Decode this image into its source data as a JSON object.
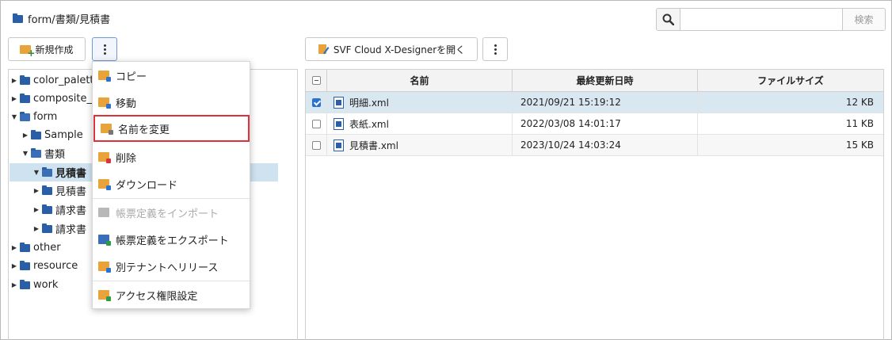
{
  "breadcrumb": {
    "path": "form/書類/見積書",
    "icon": "folder-icon"
  },
  "search": {
    "placeholder": "",
    "submit_label": "検索",
    "icon": "search-icon"
  },
  "toolbar": {
    "new_label": "新規作成",
    "designer_label": "SVF Cloud X-Designerを開く"
  },
  "tree": {
    "items": [
      {
        "label": "color_palette",
        "visible": "color_palett",
        "arrow": "▶"
      },
      {
        "label": "composite_",
        "visible": "composite_",
        "arrow": "▶"
      },
      {
        "label": "form",
        "arrow": "▼"
      },
      {
        "label": "Sample",
        "arrow": "▶"
      },
      {
        "label": "書類",
        "arrow": "▼"
      },
      {
        "label": "見積書",
        "arrow": "▼"
      },
      {
        "label": "見積書",
        "arrow": "▶"
      },
      {
        "label": "請求書",
        "arrow": "▶"
      },
      {
        "label": "請求書",
        "arrow": "▶"
      },
      {
        "label": "other",
        "arrow": "▶"
      },
      {
        "label": "resource",
        "arrow": "▶"
      },
      {
        "label": "work",
        "arrow": "▶"
      }
    ]
  },
  "table": {
    "headers": [
      "名前",
      "最終更新日時",
      "ファイルサイズ"
    ],
    "rows": [
      {
        "name": "明細.xml",
        "modified": "2021/09/21 15:19:12",
        "size": "12 KB",
        "checked": true
      },
      {
        "name": "表紙.xml",
        "modified": "2022/03/08 14:01:17",
        "size": "11 KB",
        "checked": false
      },
      {
        "name": "見積書.xml",
        "modified": "2023/10/24 14:03:24",
        "size": "15 KB",
        "checked": false
      }
    ]
  },
  "menu": {
    "items": [
      {
        "label": "コピー",
        "icon": "copy-icon",
        "disabled": false
      },
      {
        "label": "移動",
        "icon": "move-icon",
        "disabled": false
      },
      {
        "label": "名前を変更",
        "icon": "rename-icon",
        "disabled": false,
        "highlighted": true
      },
      {
        "label": "削除",
        "icon": "delete-icon",
        "disabled": false
      },
      {
        "label": "ダウンロード",
        "icon": "download-icon",
        "disabled": false
      },
      {
        "label": "帳票定義をインポート",
        "icon": "import-icon",
        "disabled": true
      },
      {
        "label": "帳票定義をエクスポート",
        "icon": "export-icon",
        "disabled": false
      },
      {
        "label": "別テナントへリリース",
        "icon": "release-icon",
        "disabled": false
      },
      {
        "label": "アクセス権限設定",
        "icon": "permission-icon",
        "disabled": false
      }
    ]
  },
  "colors": {
    "accent": "#2a5fa8",
    "selection": "#cfe2ef",
    "highlight_border": "#e0303a",
    "folder": "#e8a43a"
  }
}
